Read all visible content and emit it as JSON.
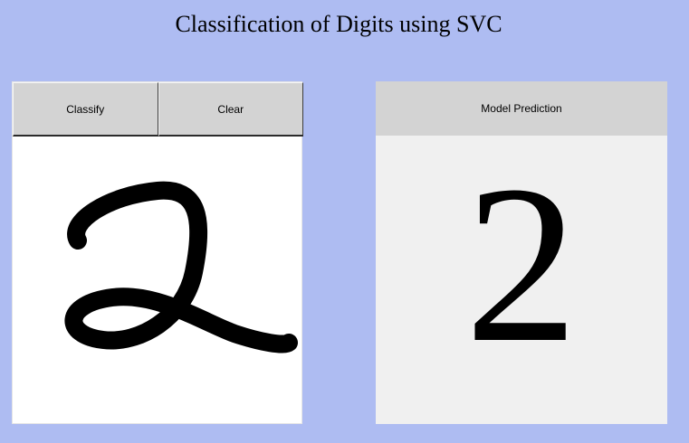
{
  "title": "Classification of Digits using SVC",
  "buttons": {
    "classify": "Classify",
    "clear": "Clear"
  },
  "prediction": {
    "header": "Model Prediction",
    "value": "2"
  },
  "colors": {
    "background": "#aebcf2",
    "button": "#d3d3d3",
    "prediction_panel": "#f0f0f0",
    "canvas": "#ffffff",
    "ink": "#000000"
  }
}
